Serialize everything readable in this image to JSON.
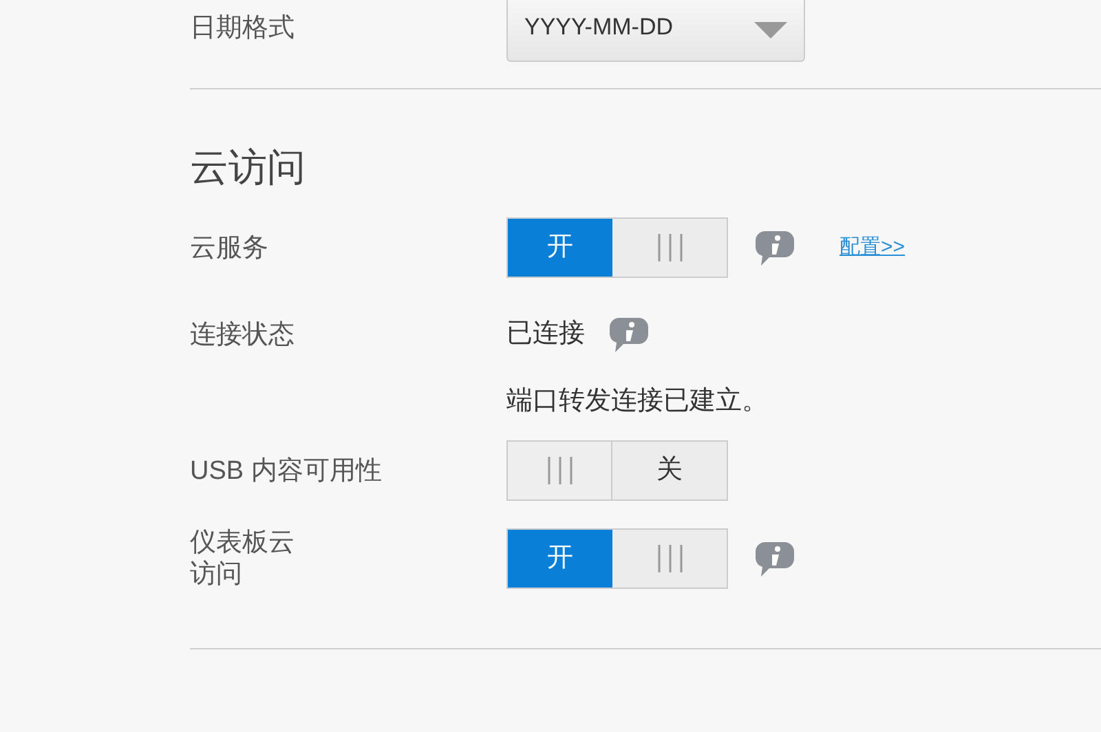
{
  "date_format": {
    "label": "日期格式",
    "value": "YYYY-MM-DD"
  },
  "cloud_access": {
    "title": "云访问",
    "rows": [
      {
        "kind": "toggle",
        "label": "云服务",
        "toggle": {
          "on": true,
          "text": "开"
        },
        "info": true,
        "link": "配置>>"
      },
      {
        "kind": "status",
        "label": "连接状态",
        "value": "已连接",
        "info": true
      },
      {
        "kind": "note",
        "value": "端口转发连接已建立。"
      },
      {
        "kind": "toggle",
        "label": "USB 内容可用性",
        "toggle": {
          "on": false,
          "text": "关"
        },
        "info": false
      },
      {
        "kind": "toggle",
        "label": "仪表板云访问",
        "toggle": {
          "on": true,
          "text": "开"
        },
        "info": true
      }
    ]
  }
}
